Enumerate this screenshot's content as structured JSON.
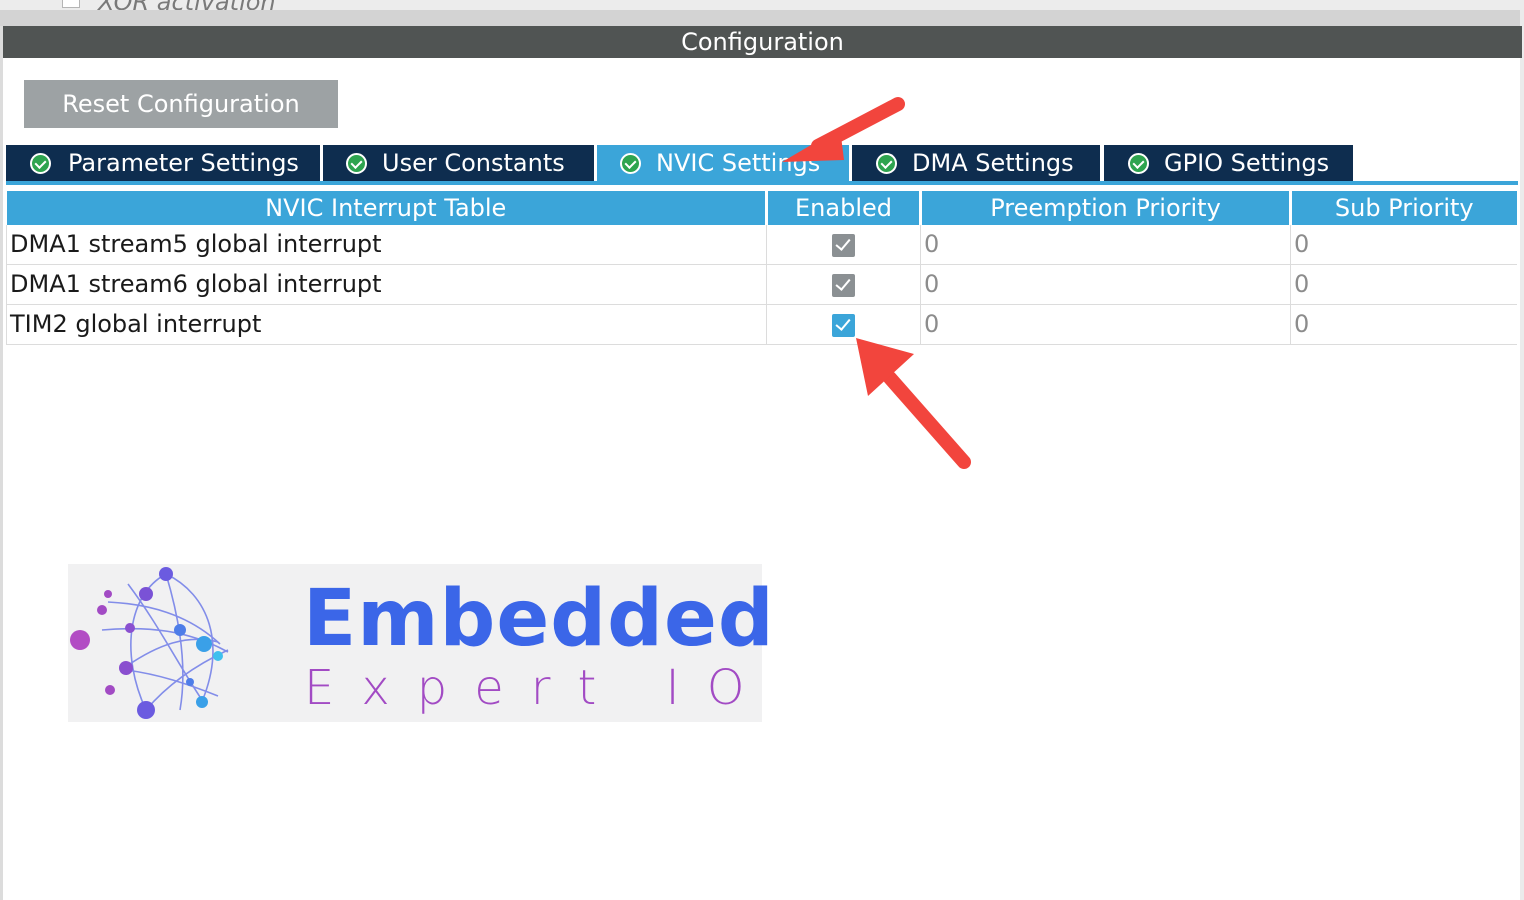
{
  "top_partial": {
    "text": "XOR activation"
  },
  "header": {
    "title": "Configuration"
  },
  "toolbar": {
    "reset_label": "Reset Configuration"
  },
  "tabs": [
    {
      "label": "Parameter Settings",
      "active": false
    },
    {
      "label": "User Constants",
      "active": false
    },
    {
      "label": "NVIC Settings",
      "active": true
    },
    {
      "label": "DMA Settings",
      "active": false
    },
    {
      "label": "GPIO Settings",
      "active": false
    }
  ],
  "table": {
    "columns": [
      "NVIC Interrupt Table",
      "Enabled",
      "Preemption Priority",
      "Sub Priority"
    ],
    "rows": [
      {
        "name": "DMA1 stream5 global interrupt",
        "enabled": true,
        "editable": false,
        "preemption": "0",
        "sub": "0"
      },
      {
        "name": "DMA1 stream6 global interrupt",
        "enabled": true,
        "editable": false,
        "preemption": "0",
        "sub": "0"
      },
      {
        "name": "TIM2 global interrupt",
        "enabled": true,
        "editable": true,
        "preemption": "0",
        "sub": "0"
      }
    ]
  },
  "logo": {
    "title": "Embedded",
    "subtitle": "Expert IO"
  },
  "colors": {
    "header_bg": "#505453",
    "tab_bg": "#0e2d4f",
    "tab_active_bg": "#3ba5d9",
    "check_green": "#2ea44f",
    "arrow_red": "#f2453d",
    "logo_blue": "#3b66e8",
    "logo_purple": "#a24bc4"
  }
}
